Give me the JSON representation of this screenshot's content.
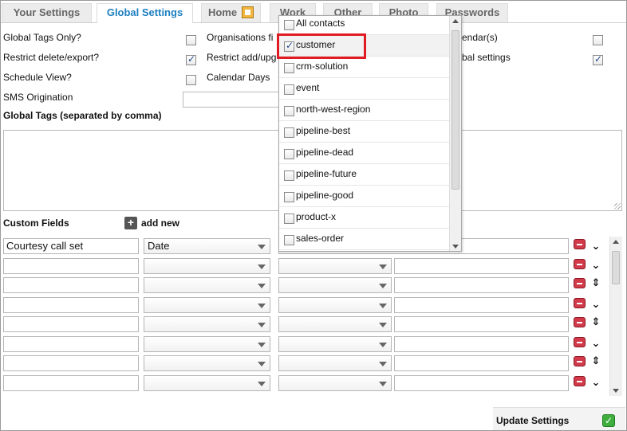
{
  "tabs": [
    {
      "label": "Your Settings"
    },
    {
      "label": "Global Settings",
      "active": true
    },
    {
      "label": "Home"
    },
    {
      "label": "Work"
    },
    {
      "label": "Other"
    },
    {
      "label": "Photo"
    },
    {
      "label": "Passwords"
    }
  ],
  "settings": {
    "global_tags_only": {
      "label": "Global Tags Only?",
      "checked": false
    },
    "restrict_delete": {
      "label": "Restrict delete/export?",
      "checked": true
    },
    "schedule_view": {
      "label": "Schedule View?",
      "checked": false
    },
    "sms_origination": {
      "label": "SMS Origination",
      "value": ""
    },
    "organisations": {
      "label": "Organisations fi",
      "checked": false
    },
    "restrict_add": {
      "label": "Restrict add/upg",
      "checked": true
    },
    "calendar_days": {
      "label": "Calendar Days"
    },
    "calendars": {
      "label": "endar(s)",
      "checked": false
    },
    "global_settings_opt": {
      "label": "bal settings",
      "checked": true
    }
  },
  "global_tags": {
    "label": "Global Tags (separated by comma)",
    "value": ""
  },
  "custom_fields": {
    "label": "Custom Fields",
    "add_new": "add new",
    "rows": [
      {
        "name": "Courtesy call set",
        "type": "Date",
        "type2": "",
        "value": ""
      },
      {
        "name": "",
        "type": "",
        "type2": "",
        "value": ""
      },
      {
        "name": "",
        "type": "",
        "type2": "",
        "value": ""
      },
      {
        "name": "",
        "type": "",
        "type2": "",
        "value": ""
      },
      {
        "name": "",
        "type": "",
        "type2": "",
        "value": ""
      },
      {
        "name": "",
        "type": "",
        "type2": "",
        "value": ""
      },
      {
        "name": "",
        "type": "",
        "type2": "",
        "value": ""
      },
      {
        "name": "",
        "type": "",
        "type2": "",
        "value": ""
      }
    ]
  },
  "tag_dropdown": {
    "items": [
      {
        "label": "All contacts",
        "checked": false
      },
      {
        "label": "customer",
        "checked": true,
        "highlighted": true
      },
      {
        "label": "crm-solution",
        "checked": false
      },
      {
        "label": "event",
        "checked": false
      },
      {
        "label": "north-west-region",
        "checked": false
      },
      {
        "label": "pipeline-best",
        "checked": false
      },
      {
        "label": "pipeline-dead",
        "checked": false
      },
      {
        "label": "pipeline-future",
        "checked": false
      },
      {
        "label": "pipeline-good",
        "checked": false
      },
      {
        "label": "product-x",
        "checked": false
      },
      {
        "label": "sales-order",
        "checked": false
      }
    ]
  },
  "update_button": {
    "label": "Update Settings"
  },
  "colors": {
    "active_tab": "#1e7fc0",
    "highlight": "#e01b24",
    "delete": "#d23a4a",
    "ok": "#3fae3f"
  }
}
